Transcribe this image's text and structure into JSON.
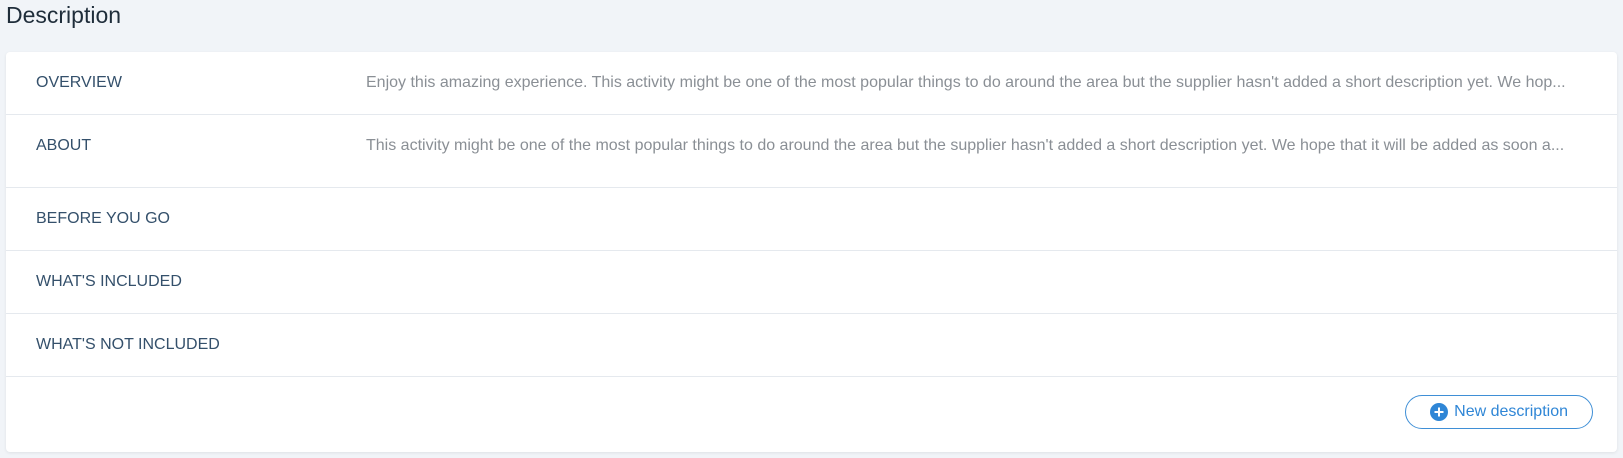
{
  "page": {
    "title": "Description"
  },
  "descriptions": [
    {
      "label": "OVERVIEW",
      "text": "Enjoy this amazing experience. This activity might be one of the most popular things to do around the area but the supplier hasn't added a short description yet. We hop..."
    },
    {
      "label": "ABOUT",
      "text": "This activity might be one of the most popular things to do around the area but the supplier hasn't added a short description yet. We hope that it will be added as soon a..."
    },
    {
      "label": "BEFORE YOU GO",
      "text": ""
    },
    {
      "label": "WHAT'S INCLUDED",
      "text": ""
    },
    {
      "label": "WHAT'S NOT INCLUDED",
      "text": ""
    }
  ],
  "actions": {
    "new_description_label": "New description",
    "new_description_icon": "plus-circle-icon"
  },
  "colors": {
    "accent": "#2f86d6",
    "label": "#34506b",
    "text": "#8a8f95",
    "background": "#f1f4f8"
  }
}
